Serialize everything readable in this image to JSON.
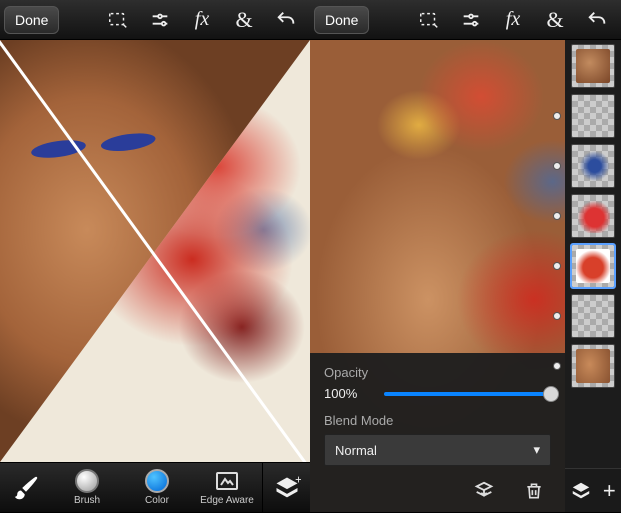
{
  "toolbar": {
    "done_label": "Done"
  },
  "modes": {
    "brush_label": "Brush",
    "color_label": "Color",
    "edge_label": "Edge Aware"
  },
  "props": {
    "opacity_label": "Opacity",
    "opacity_value": "100%",
    "blend_label": "Blend Mode",
    "blend_value": "Normal"
  },
  "icons": {
    "select": "select-marquee",
    "crop": "crop",
    "fx": "fx",
    "ampersand": "&",
    "undo": "undo",
    "brush": "paintbrush",
    "layers": "layers-stack",
    "add_layer": "add",
    "merge": "merge-down",
    "trash": "trash",
    "chevron": "▾"
  }
}
